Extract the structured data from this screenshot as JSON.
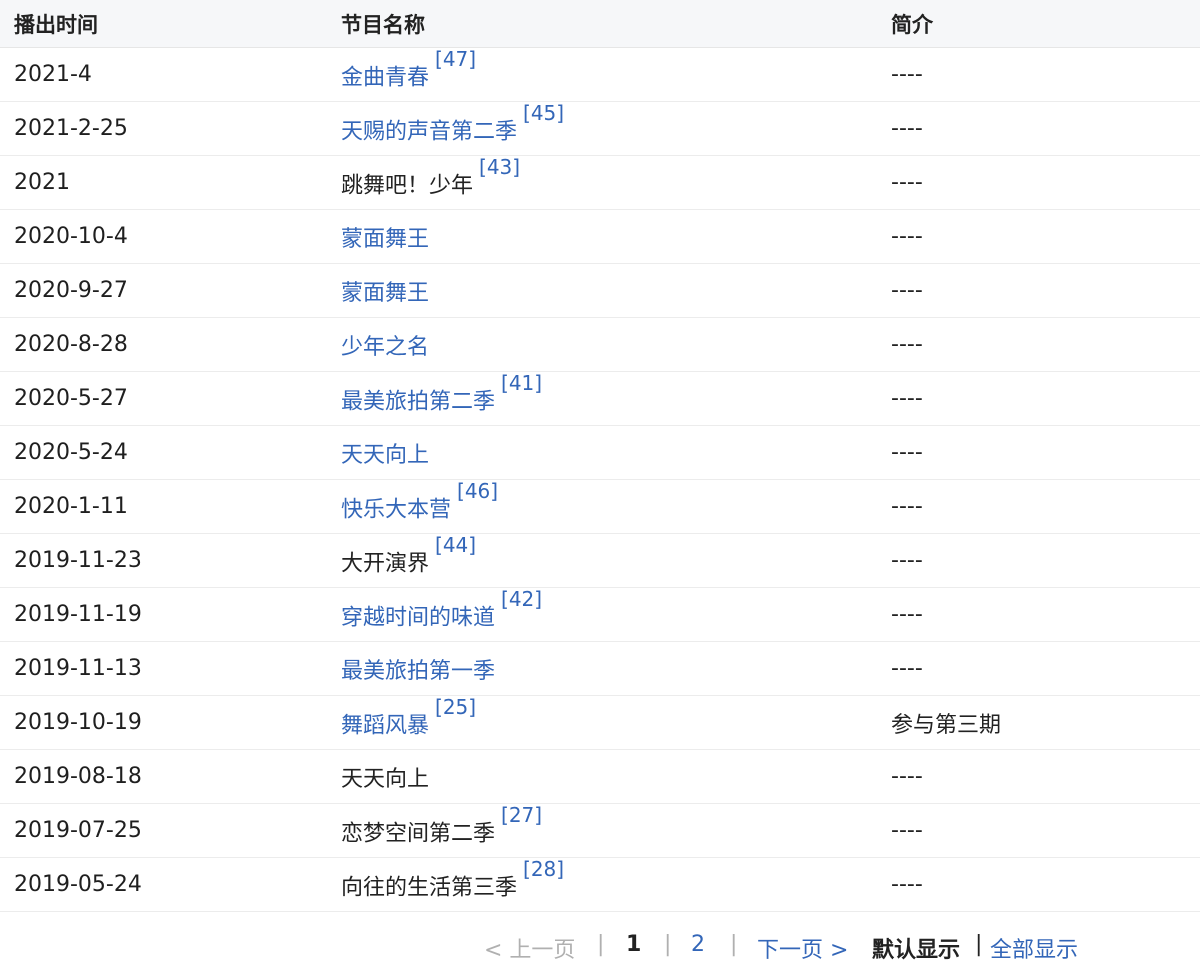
{
  "table": {
    "headers": {
      "date": "播出时间",
      "name": "节目名称",
      "desc": "简介"
    },
    "rows": [
      {
        "date": "2021-4",
        "name": "金曲青春",
        "ref": "[47]",
        "desc": "----",
        "linked": true
      },
      {
        "date": "2021-2-25",
        "name": "天赐的声音第二季",
        "ref": "[45]",
        "desc": "----",
        "linked": true
      },
      {
        "date": "2021",
        "name": "跳舞吧！少年",
        "ref": "[43]",
        "desc": "----",
        "linked": false
      },
      {
        "date": "2020-10-4",
        "name": "蒙面舞王",
        "ref": "",
        "desc": "----",
        "linked": true
      },
      {
        "date": "2020-9-27",
        "name": "蒙面舞王",
        "ref": "",
        "desc": "----",
        "linked": true
      },
      {
        "date": "2020-8-28",
        "name": "少年之名",
        "ref": "",
        "desc": "----",
        "linked": true
      },
      {
        "date": "2020-5-27",
        "name": "最美旅拍第二季",
        "ref": "[41]",
        "desc": "----",
        "linked": true
      },
      {
        "date": "2020-5-24",
        "name": "天天向上",
        "ref": "",
        "desc": "----",
        "linked": true
      },
      {
        "date": "2020-1-11",
        "name": "快乐大本营",
        "ref": "[46]",
        "desc": "----",
        "linked": true
      },
      {
        "date": "2019-11-23",
        "name": "大开演界",
        "ref": "[44]",
        "desc": "----",
        "linked": false
      },
      {
        "date": "2019-11-19",
        "name": "穿越时间的味道",
        "ref": "[42]",
        "desc": "----",
        "linked": true
      },
      {
        "date": "2019-11-13",
        "name": "最美旅拍第一季",
        "ref": "",
        "desc": "----",
        "linked": true
      },
      {
        "date": "2019-10-19",
        "name": "舞蹈风暴",
        "ref": "[25]",
        "desc": "参与第三期",
        "linked": true
      },
      {
        "date": "2019-08-18",
        "name": "天天向上",
        "ref": "",
        "desc": "----",
        "linked": false
      },
      {
        "date": "2019-07-25",
        "name": "恋梦空间第二季",
        "ref": "[27]",
        "desc": "----",
        "linked": false
      },
      {
        "date": "2019-05-24",
        "name": "向往的生活第三季",
        "ref": "[28]",
        "desc": "----",
        "linked": false
      }
    ]
  },
  "pager": {
    "prev": "< 上一页",
    "sep": "|",
    "current": "1",
    "page2": "2",
    "next": "下一页 >",
    "default_view": "默认显示",
    "bar": "|",
    "all_view": "全部显示"
  }
}
